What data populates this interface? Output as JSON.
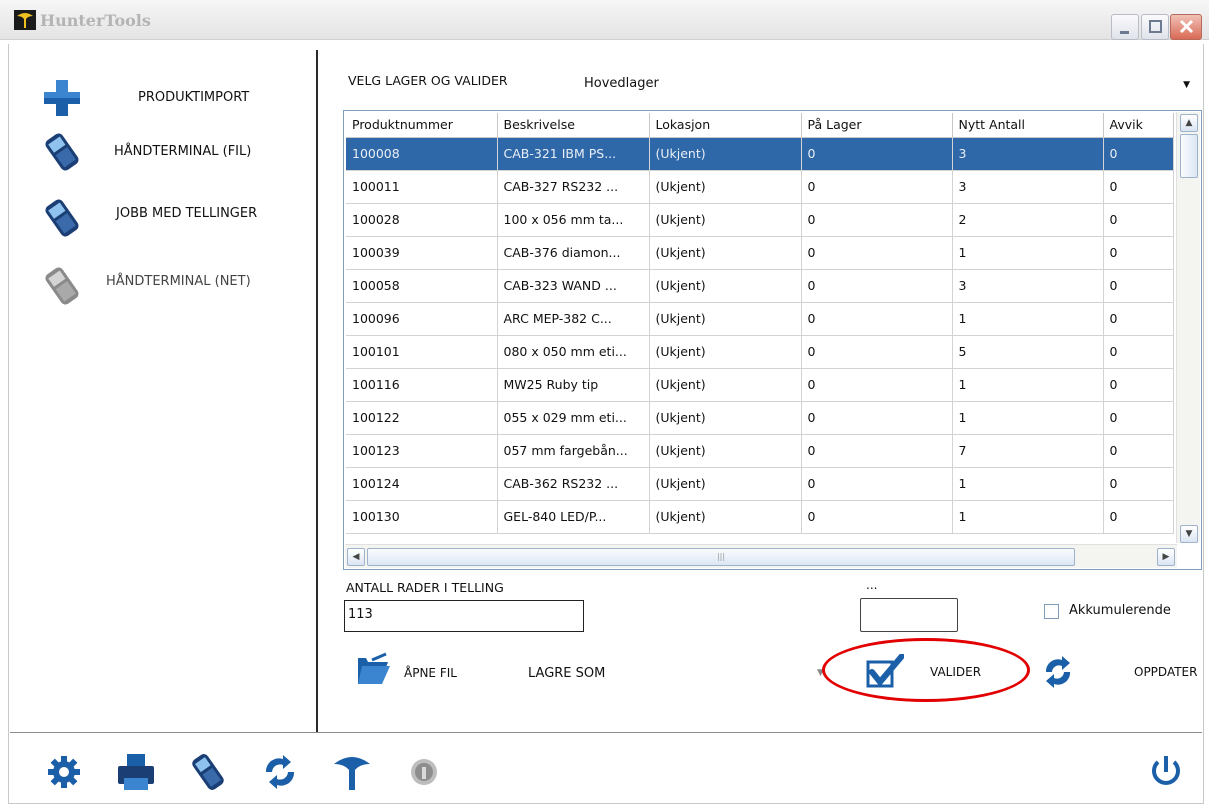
{
  "window": {
    "title": "HunterTools"
  },
  "sidebar": {
    "items": [
      {
        "label": "PRODUKTIMPORT",
        "icon": "plus-icon"
      },
      {
        "label": "HÅNDTERMINAL (FIL)",
        "icon": "handheld-icon"
      },
      {
        "label": "JOBB MED TELLINGER",
        "icon": "handheld-icon"
      },
      {
        "label": "HÅNDTERMINAL (NET)",
        "icon": "handheld-disabled-icon"
      }
    ]
  },
  "warehouse": {
    "label": "VELG LAGER OG VALIDER",
    "selected": "Hovedlager"
  },
  "grid": {
    "columns": [
      "Produktnummer",
      "Beskrivelse",
      "Lokasjon",
      "På Lager",
      "Nytt Antall",
      "Avvik"
    ],
    "selected_row": 0,
    "rows": [
      [
        "100008",
        "CAB-321 IBM PS...",
        "(Ukjent)",
        "0",
        "3",
        "0"
      ],
      [
        "100011",
        "CAB-327 RS232 ...",
        "(Ukjent)",
        "0",
        "3",
        "0"
      ],
      [
        "100028",
        "100 x 056 mm ta...",
        "(Ukjent)",
        "0",
        "2",
        "0"
      ],
      [
        "100039",
        "CAB-376 diamon...",
        "(Ukjent)",
        "0",
        "1",
        "0"
      ],
      [
        "100058",
        "CAB-323 WAND ...",
        "(Ukjent)",
        "0",
        "3",
        "0"
      ],
      [
        "100096",
        "ARC MEP-382 C...",
        "(Ukjent)",
        "0",
        "1",
        "0"
      ],
      [
        "100101",
        "080 x 050 mm eti...",
        "(Ukjent)",
        "0",
        "5",
        "0"
      ],
      [
        "100116",
        "MW25 Ruby tip",
        "(Ukjent)",
        "0",
        "1",
        "0"
      ],
      [
        "100122",
        "055 x 029 mm eti...",
        "(Ukjent)",
        "0",
        "1",
        "0"
      ],
      [
        "100123",
        "057 mm fargebån...",
        "(Ukjent)",
        "0",
        "7",
        "0"
      ],
      [
        "100124",
        "CAB-362 RS232 ...",
        "(Ukjent)",
        "0",
        "1",
        "0"
      ],
      [
        "100130",
        "GEL-840 LED/P...",
        "(Ukjent)",
        "0",
        "1",
        "0"
      ]
    ]
  },
  "count": {
    "label": "ANTALL RADER I TELLING",
    "value": "113"
  },
  "extra": {
    "dots": "...",
    "input_value": ""
  },
  "accumulate": {
    "label": "Akkumulerende",
    "checked": false
  },
  "actions": {
    "open_label": "ÅPNE FIL",
    "save_as": "LAGRE SOM",
    "validate_label": "VALIDER",
    "refresh_label": "OPPDATER"
  },
  "colors": {
    "accent": "#2f68a8",
    "highlight": "#e20000",
    "icon_blue": "#1b5fa8"
  }
}
